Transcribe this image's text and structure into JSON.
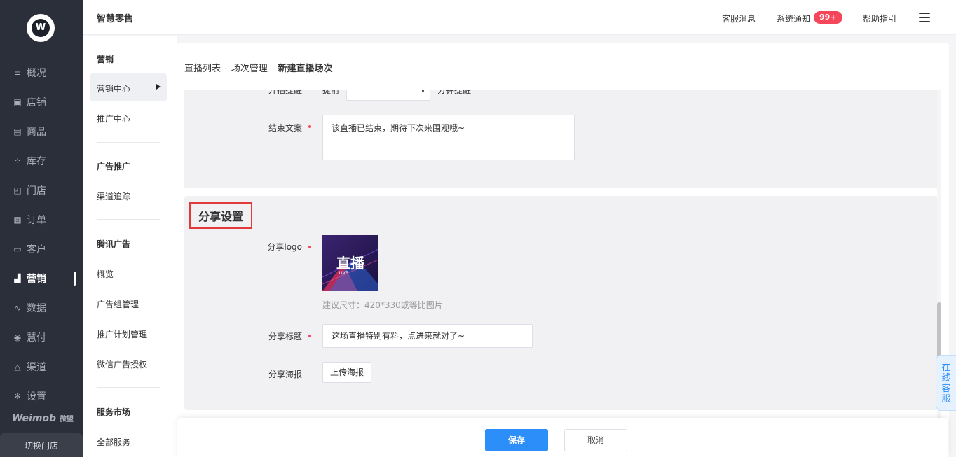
{
  "app": {
    "brand_mark": "W",
    "title": "智慧零售"
  },
  "topbar": {
    "customer_service": "客服消息",
    "system_notice": "系统通知",
    "notice_badge": "99+",
    "help": "帮助指引"
  },
  "nav": {
    "items": [
      {
        "label": "概况",
        "icon": "list-icon"
      },
      {
        "label": "店铺",
        "icon": "store-icon"
      },
      {
        "label": "商品",
        "icon": "goods-icon"
      },
      {
        "label": "库存",
        "icon": "inventory-icon"
      },
      {
        "label": "门店",
        "icon": "shop-icon"
      },
      {
        "label": "订单",
        "icon": "order-icon"
      },
      {
        "label": "客户",
        "icon": "customer-icon"
      },
      {
        "label": "营销",
        "icon": "chart-icon"
      },
      {
        "label": "数据",
        "icon": "data-icon"
      },
      {
        "label": "慧付",
        "icon": "pay-icon"
      },
      {
        "label": "渠道",
        "icon": "channel-icon"
      },
      {
        "label": "设置",
        "icon": "settings-icon"
      }
    ],
    "active": "营销",
    "brand": "Weimob",
    "brand_cn": "微盟",
    "switch_store": "切换门店"
  },
  "subnav": {
    "marketing_head": "营销",
    "marketing_center": "营销中心",
    "promotion_center": "推广中心",
    "ad_head": "广告推广",
    "channel_tracking": "渠道追踪",
    "tencent_head": "腾讯广告",
    "overview": "概览",
    "ad_group_mgmt": "广告组管理",
    "plan_mgmt": "推广计划管理",
    "wechat_ad_auth": "微信广告授权",
    "market_head": "服务市场",
    "all_services": "全部服务"
  },
  "breadcrumb": {
    "level1": "直播列表",
    "level2": "场次管理",
    "current": "新建直播场次",
    "separator": "-"
  },
  "form": {
    "hidden_label": "开播提醒",
    "hidden_prefix": "提前",
    "hidden_suffix": "分钟提醒",
    "end_text_label": "结束文案",
    "end_text_value": "该直播已结束，期待下次来围观哦~",
    "share_section_title": "分享设置",
    "share_logo_label": "分享logo",
    "logo_image_text": "直播",
    "logo_image_subtext": "LIVE",
    "logo_tip": "建议尺寸：420*330或等比图片",
    "share_title_label": "分享标题",
    "share_title_value": "这场直播特别有料，点进来就对了~",
    "share_poster_label": "分享海报",
    "upload_poster": "上传海报"
  },
  "footer": {
    "save": "保存",
    "cancel": "取消"
  },
  "online_service": "在线客服",
  "colors": {
    "nav_bg": "#2b2f3a",
    "primary": "#2b8ef9",
    "badge": "#f5465a",
    "highlight_border": "#e03a3a"
  }
}
